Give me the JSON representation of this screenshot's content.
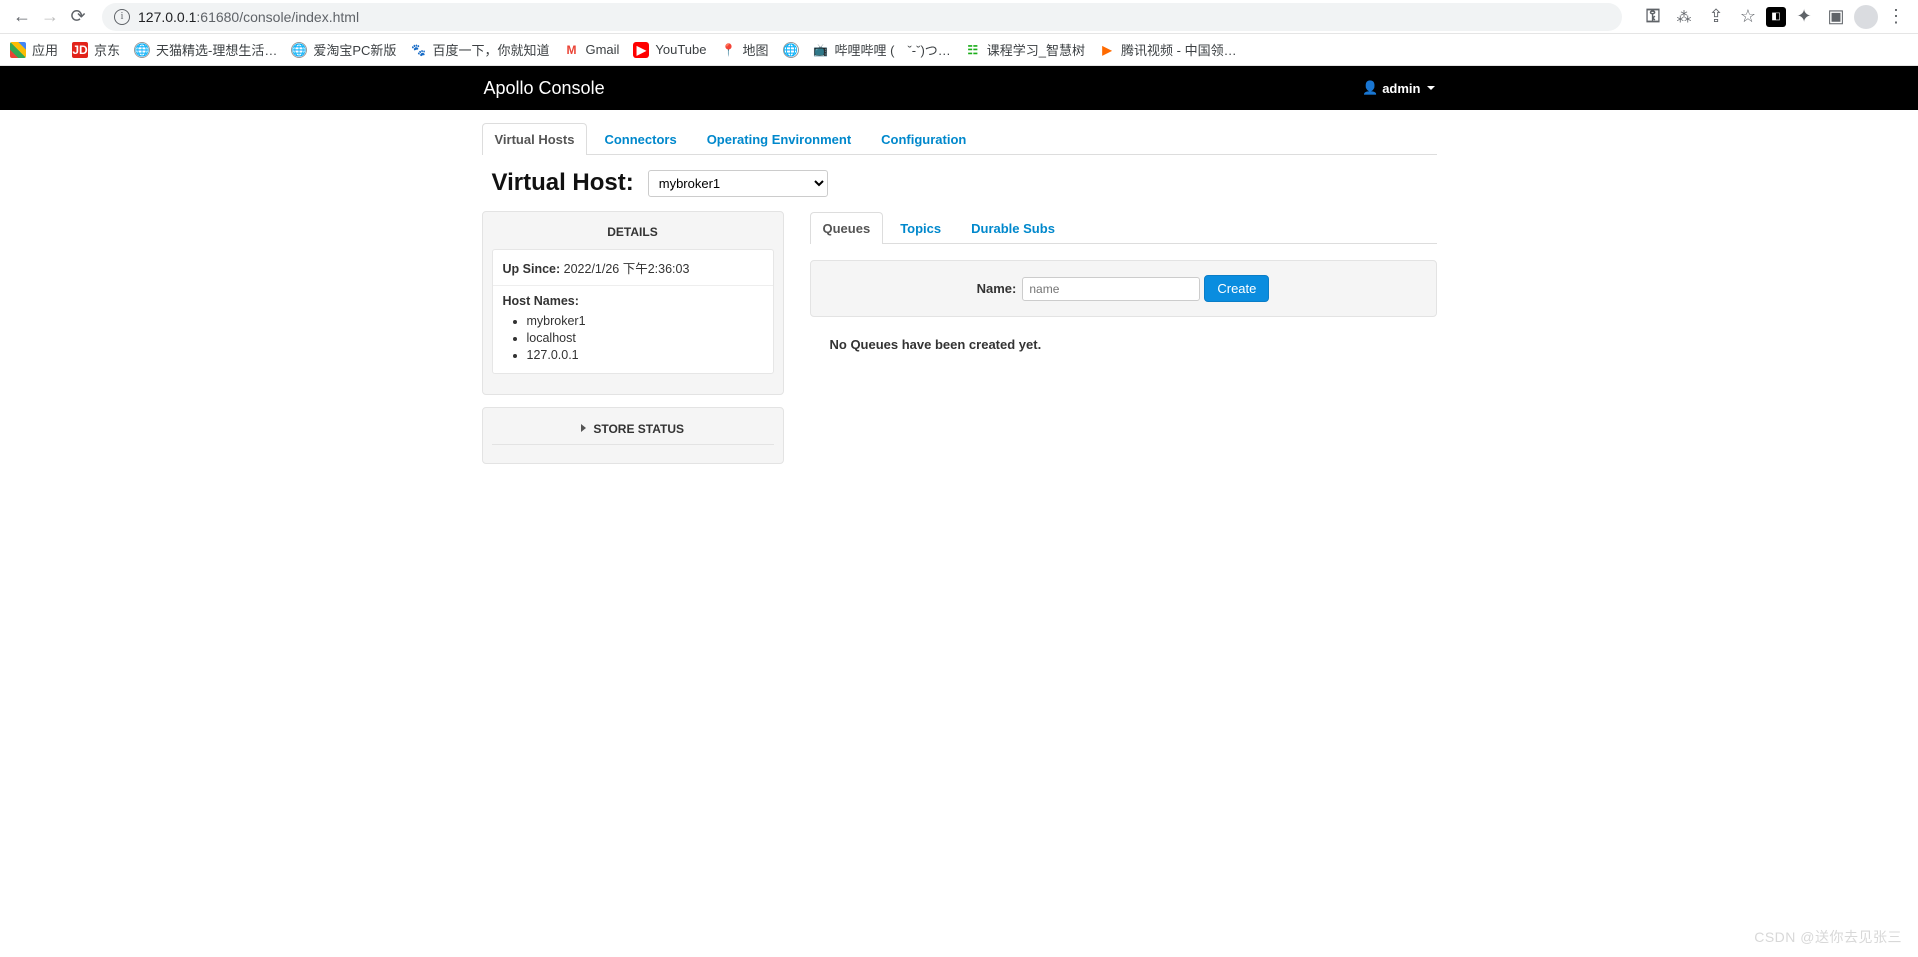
{
  "browser": {
    "url_host": "127.0.0.1",
    "url_port_path": ":61680/console/index.html"
  },
  "bookmarks": {
    "apps": "应用",
    "jd": "京东",
    "tmall": "天猫精选-理想生活…",
    "aitaobao": "爱淘宝PC新版",
    "baidu": "百度一下，你就知道",
    "gmail": "Gmail",
    "youtube": "YouTube",
    "maps": "地图",
    "bilibili": "哔哩哔哩 (　ˇ-ˇ)つ…",
    "zhihuishu": "课程学习_智慧树",
    "tencent": "腾讯视频 - 中国领…"
  },
  "header": {
    "brand": "Apollo Console",
    "admin": "admin"
  },
  "mainTabs": {
    "virtualHosts": "Virtual Hosts",
    "connectors": "Connectors",
    "operatingEnv": "Operating Environment",
    "configuration": "Configuration"
  },
  "virtualHost": {
    "label": "Virtual Host:",
    "selected": "mybroker1"
  },
  "details": {
    "heading": "DETAILS",
    "upSinceLabel": "Up Since:",
    "upSinceValue": "2022/1/26 下午2:36:03",
    "hostNamesLabel": "Host Names:",
    "hostNames": [
      "mybroker1",
      "localhost",
      "127.0.0.1"
    ]
  },
  "storeStatus": {
    "label": "STORE STATUS"
  },
  "subTabs": {
    "queues": "Queues",
    "topics": "Topics",
    "durableSubs": "Durable Subs"
  },
  "createForm": {
    "label": "Name:",
    "placeholder": "name",
    "button": "Create"
  },
  "emptyMessage": "No Queues have been created yet.",
  "watermark": "CSDN @送你去见张三"
}
